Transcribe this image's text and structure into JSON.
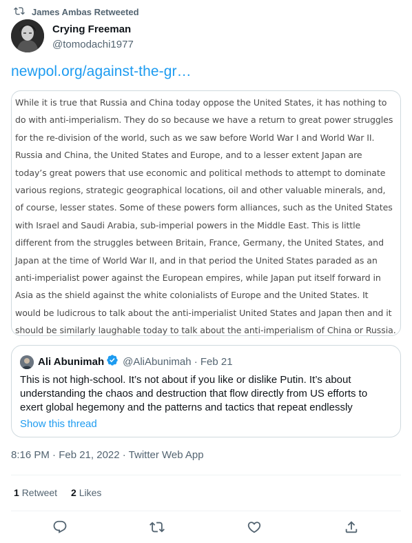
{
  "retweet_banner": {
    "label": "James Ambas Retweeted",
    "icon": "retweet-icon"
  },
  "author": {
    "display_name": "Crying Freeman",
    "handle": "@tomodachi1977"
  },
  "link_text": "newpol.org/against-the-gr…",
  "image_text": "While it is true that Russia and China today oppose the United States, it has nothing to do with anti-imperialism. They do so because we have a return to great power struggles for the re-division of the world, such as we saw before World War I and World War II. Russia and China, the United States and Europe, and to a lesser extent Japan are today’s great powers that use economic and political methods to attempt to dominate various regions, strategic geographical locations, oil and other valuable minerals, and, of course, lesser states. Some of these powers form alliances, such as the United States with Israel and Saudi Arabia, sub-imperial powers in the Middle East. This is little different from the struggles between Britain, France, Germany, the United States, and Japan at the time of World War II, and in that period the United States paraded as an anti-imperialist power against the European empires, while Japan put itself forward in Asia as the shield against the white colonialists of Europe and the United States. It would be ludicrous to talk about the anti-imperialist United States and Japan then and it should be similarly laughable today to talk about the anti-imperialism of China or Russia.",
  "quoted": {
    "name": "Ali Abunimah",
    "handle_date": "@AliAbunimah · Feb 21",
    "text": "This is not high-school. It’s not about if you like or dislike Putin. It’s about understanding the chaos and destruction that flow directly from US efforts to exert global hegemony and the patterns and tactics that repeat endlessly",
    "show_thread": "Show this thread"
  },
  "meta": "8:16 PM · Feb 21, 2022 · Twitter Web App",
  "stats": {
    "retweets_count": "1",
    "retweets_label": "Retweet",
    "likes_count": "2",
    "likes_label": "Likes"
  },
  "colors": {
    "accent": "#1d9bf0",
    "secondary_text": "#536471",
    "border": "#cfd9de"
  }
}
